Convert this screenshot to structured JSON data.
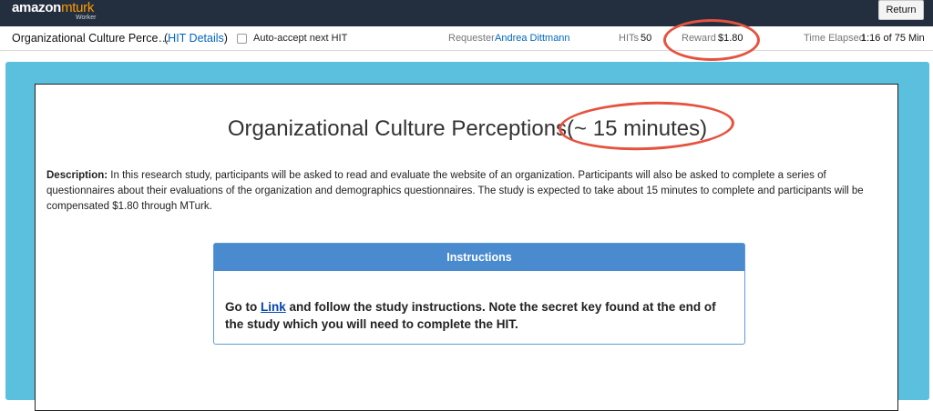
{
  "brand": {
    "amazon": "amazon",
    "mturk": "mturk",
    "sub": "Worker"
  },
  "topbar": {
    "return_label": "Return"
  },
  "hitbar": {
    "title": "Organizational Culture Perce…",
    "details_open": "(",
    "details_label": "HIT Details",
    "details_close": ")",
    "auto_accept_label": "Auto-accept next HIT",
    "auto_accept_checked": false,
    "requester_label": "Requester",
    "requester_name": "Andrea Dittmann",
    "hits_label": "HITs",
    "hits_value": "50",
    "reward_label": "Reward",
    "reward_value": "$1.80",
    "elapsed_label": "Time Elapsed",
    "elapsed_value": "1:16 of 75 Min"
  },
  "content": {
    "title": "Organizational Culture Perceptions(~ 15 minutes)",
    "description_label": "Description:",
    "description_text": " In this research study, participants will be asked to read and evaluate the website of an organization. Participants will also be asked to complete a series of questionnaires about their evaluations of the organization and demographics questionnaires. The study is expected to take about 15 minutes to complete and participants will be compensated $1.80 through MTurk.",
    "instructions_heading": "Instructions",
    "instr_before": "Go to ",
    "instr_link": "Link",
    "instr_after": " and follow the study instructions. Note the secret key found at the end of the study which you will need to complete the HIT."
  },
  "colors": {
    "topbar": "#232f3e",
    "frame": "#5bc0de",
    "instructions_header": "#4a8bcf",
    "annotation_ring": "#e5533f",
    "link": "#0066c0"
  }
}
